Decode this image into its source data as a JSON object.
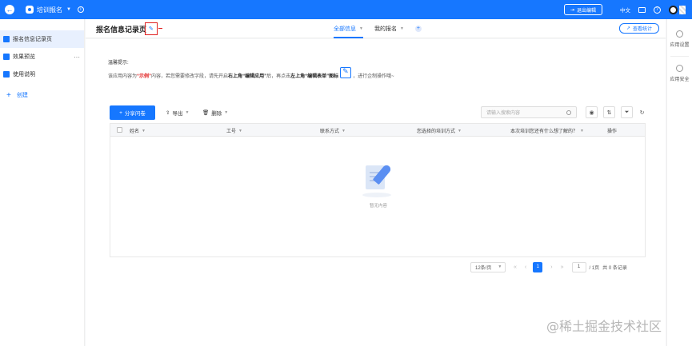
{
  "topbar": {
    "app_name": "培训报名",
    "exit_edit": "退出编辑",
    "language": "中文",
    "icons": [
      "back-icon",
      "app-icon",
      "info-icon",
      "mail-icon",
      "help-icon",
      "avatar"
    ],
    "color": "#1677ff"
  },
  "sidebar": {
    "items": [
      {
        "label": "报名信息记录页",
        "active": true
      },
      {
        "label": "效果预览",
        "more": "···"
      },
      {
        "label": "使用说明"
      }
    ],
    "create_label": "创建"
  },
  "header": {
    "title": "报名信息记录页",
    "tabs": [
      {
        "label": "全部信息",
        "active": true
      },
      {
        "label": "我的报名"
      }
    ],
    "stats_button": "查看统计"
  },
  "notice": {
    "title": "温馨提示:",
    "parts": {
      "p1": "该应用内容为",
      "example": "“示例”",
      "p2": "内容，若您需要修改字段，请先开启",
      "b1": "右上角",
      "b2": "“编辑应用”",
      "p3": "后，再点击",
      "b3": "左上角",
      "b4": "“编辑表单”",
      "b5": "图标",
      "p4": "，进行企制操作哦~"
    }
  },
  "toolbar": {
    "share": "分享问卷",
    "export": "导出",
    "delete": "删除",
    "search_placeholder": "请输入搜索内容"
  },
  "table": {
    "columns": [
      "姓名",
      "工号",
      "联系方式",
      "您选择的培训方式",
      "本次培训您还有什么想了解的？",
      "操作"
    ],
    "rows": [],
    "empty_text": "暂无内容"
  },
  "pagination": {
    "page_size": "12条/页",
    "current_page": "1",
    "jump_value": "1",
    "total_pages": "/ 1页",
    "total_records": "共 0 条记录"
  },
  "rail": {
    "items": [
      "应用设置",
      "应用安全"
    ]
  },
  "watermark": "@稀土掘金技术社区"
}
